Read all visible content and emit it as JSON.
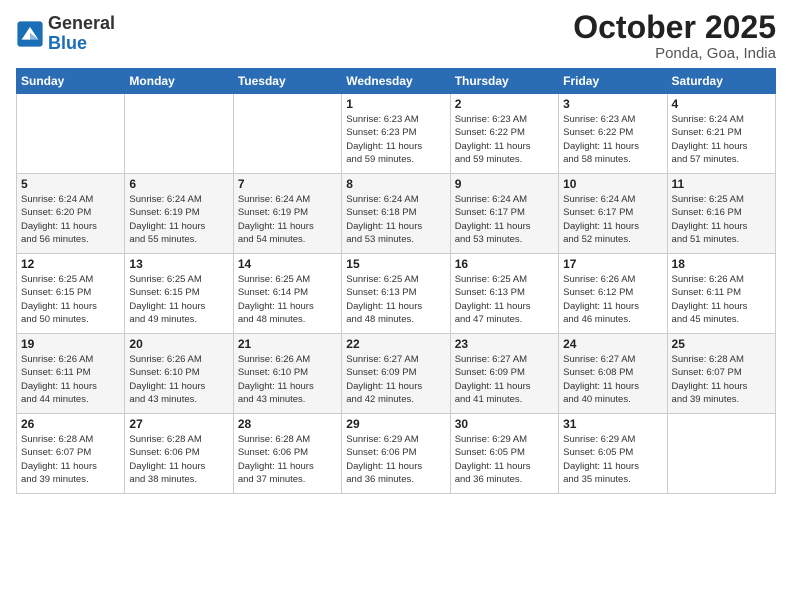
{
  "logo": {
    "general": "General",
    "blue": "Blue"
  },
  "header": {
    "month": "October 2025",
    "location": "Ponda, Goa, India"
  },
  "days_of_week": [
    "Sunday",
    "Monday",
    "Tuesday",
    "Wednesday",
    "Thursday",
    "Friday",
    "Saturday"
  ],
  "weeks": [
    [
      null,
      null,
      null,
      {
        "day": 1,
        "sunrise": "6:23 AM",
        "sunset": "6:23 PM",
        "daylight": "11 hours and 59 minutes."
      },
      {
        "day": 2,
        "sunrise": "6:23 AM",
        "sunset": "6:22 PM",
        "daylight": "11 hours and 59 minutes."
      },
      {
        "day": 3,
        "sunrise": "6:23 AM",
        "sunset": "6:22 PM",
        "daylight": "11 hours and 58 minutes."
      },
      {
        "day": 4,
        "sunrise": "6:24 AM",
        "sunset": "6:21 PM",
        "daylight": "11 hours and 57 minutes."
      }
    ],
    [
      {
        "day": 5,
        "sunrise": "6:24 AM",
        "sunset": "6:20 PM",
        "daylight": "11 hours and 56 minutes."
      },
      {
        "day": 6,
        "sunrise": "6:24 AM",
        "sunset": "6:19 PM",
        "daylight": "11 hours and 55 minutes."
      },
      {
        "day": 7,
        "sunrise": "6:24 AM",
        "sunset": "6:19 PM",
        "daylight": "11 hours and 54 minutes."
      },
      {
        "day": 8,
        "sunrise": "6:24 AM",
        "sunset": "6:18 PM",
        "daylight": "11 hours and 53 minutes."
      },
      {
        "day": 9,
        "sunrise": "6:24 AM",
        "sunset": "6:17 PM",
        "daylight": "11 hours and 53 minutes."
      },
      {
        "day": 10,
        "sunrise": "6:24 AM",
        "sunset": "6:17 PM",
        "daylight": "11 hours and 52 minutes."
      },
      {
        "day": 11,
        "sunrise": "6:25 AM",
        "sunset": "6:16 PM",
        "daylight": "11 hours and 51 minutes."
      }
    ],
    [
      {
        "day": 12,
        "sunrise": "6:25 AM",
        "sunset": "6:15 PM",
        "daylight": "11 hours and 50 minutes."
      },
      {
        "day": 13,
        "sunrise": "6:25 AM",
        "sunset": "6:15 PM",
        "daylight": "11 hours and 49 minutes."
      },
      {
        "day": 14,
        "sunrise": "6:25 AM",
        "sunset": "6:14 PM",
        "daylight": "11 hours and 48 minutes."
      },
      {
        "day": 15,
        "sunrise": "6:25 AM",
        "sunset": "6:13 PM",
        "daylight": "11 hours and 48 minutes."
      },
      {
        "day": 16,
        "sunrise": "6:25 AM",
        "sunset": "6:13 PM",
        "daylight": "11 hours and 47 minutes."
      },
      {
        "day": 17,
        "sunrise": "6:26 AM",
        "sunset": "6:12 PM",
        "daylight": "11 hours and 46 minutes."
      },
      {
        "day": 18,
        "sunrise": "6:26 AM",
        "sunset": "6:11 PM",
        "daylight": "11 hours and 45 minutes."
      }
    ],
    [
      {
        "day": 19,
        "sunrise": "6:26 AM",
        "sunset": "6:11 PM",
        "daylight": "11 hours and 44 minutes."
      },
      {
        "day": 20,
        "sunrise": "6:26 AM",
        "sunset": "6:10 PM",
        "daylight": "11 hours and 43 minutes."
      },
      {
        "day": 21,
        "sunrise": "6:26 AM",
        "sunset": "6:10 PM",
        "daylight": "11 hours and 43 minutes."
      },
      {
        "day": 22,
        "sunrise": "6:27 AM",
        "sunset": "6:09 PM",
        "daylight": "11 hours and 42 minutes."
      },
      {
        "day": 23,
        "sunrise": "6:27 AM",
        "sunset": "6:09 PM",
        "daylight": "11 hours and 41 minutes."
      },
      {
        "day": 24,
        "sunrise": "6:27 AM",
        "sunset": "6:08 PM",
        "daylight": "11 hours and 40 minutes."
      },
      {
        "day": 25,
        "sunrise": "6:28 AM",
        "sunset": "6:07 PM",
        "daylight": "11 hours and 39 minutes."
      }
    ],
    [
      {
        "day": 26,
        "sunrise": "6:28 AM",
        "sunset": "6:07 PM",
        "daylight": "11 hours and 39 minutes."
      },
      {
        "day": 27,
        "sunrise": "6:28 AM",
        "sunset": "6:06 PM",
        "daylight": "11 hours and 38 minutes."
      },
      {
        "day": 28,
        "sunrise": "6:28 AM",
        "sunset": "6:06 PM",
        "daylight": "11 hours and 37 minutes."
      },
      {
        "day": 29,
        "sunrise": "6:29 AM",
        "sunset": "6:06 PM",
        "daylight": "11 hours and 36 minutes."
      },
      {
        "day": 30,
        "sunrise": "6:29 AM",
        "sunset": "6:05 PM",
        "daylight": "11 hours and 36 minutes."
      },
      {
        "day": 31,
        "sunrise": "6:29 AM",
        "sunset": "6:05 PM",
        "daylight": "11 hours and 35 minutes."
      },
      null
    ]
  ],
  "labels": {
    "sunrise": "Sunrise:",
    "sunset": "Sunset:",
    "daylight": "Daylight:"
  }
}
